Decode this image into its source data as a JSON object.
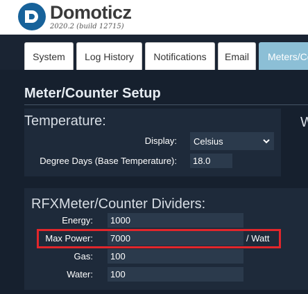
{
  "app": {
    "name": "Domoticz",
    "version": "2020.2 (build 12715)"
  },
  "tabs": [
    {
      "label": "System"
    },
    {
      "label": "Log History"
    },
    {
      "label": "Notifications"
    },
    {
      "label": "Email"
    },
    {
      "label": "Meters/Counters"
    }
  ],
  "page": {
    "title": "Meter/Counter Setup"
  },
  "temperature": {
    "title": "Temperature:",
    "display_label": "Display:",
    "display_value": "Celsius",
    "degree_days_label": "Degree Days (Base Temperature):",
    "degree_days_value": "18.0"
  },
  "rfx": {
    "title": "RFXMeter/Counter Dividers:",
    "energy_label": "Energy:",
    "energy_value": "1000",
    "max_power_label": "Max Power:",
    "max_power_value": "7000",
    "max_power_unit": "/ Watt",
    "gas_label": "Gas:",
    "gas_value": "100",
    "water_label": "Water:",
    "water_value": "100"
  },
  "next_panel_peek": "W",
  "colors": {
    "background": "#1a2433",
    "active_tab": "#8cbfd6",
    "highlight": "#e2262b",
    "logo": "#17629a"
  }
}
